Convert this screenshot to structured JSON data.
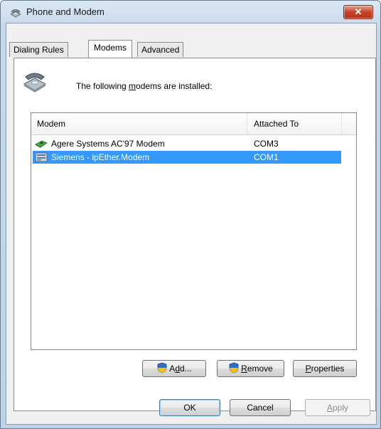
{
  "window": {
    "title": "Phone and Modem",
    "close_glyph": "✕"
  },
  "tabs": [
    {
      "label": "Dialing Rules",
      "selected": false
    },
    {
      "label": "Modems",
      "selected": true
    },
    {
      "label": "Advanced",
      "selected": false
    }
  ],
  "modems_tab": {
    "intro_pre": "The following ",
    "intro_ul": "m",
    "intro_post": "odems are installed:",
    "columns": [
      "Modem",
      "Attached To"
    ],
    "rows": [
      {
        "name": "Agere Systems AC'97 Modem",
        "port": "COM3",
        "icon": "modem-card-icon",
        "selected": false
      },
      {
        "name": "Siemens - ipEther.Modem",
        "port": "COM1",
        "icon": "modem-device-icon",
        "selected": true
      }
    ],
    "buttons": {
      "add": {
        "pre": "A",
        "ul": "d",
        "post": "d..."
      },
      "remove": {
        "ul": "R",
        "post": "emove"
      },
      "properties": {
        "ul": "P",
        "post": "roperties"
      }
    }
  },
  "footer": {
    "ok": "OK",
    "cancel": "Cancel",
    "apply": {
      "ul": "A",
      "post": "pply",
      "disabled": true
    }
  },
  "colors": {
    "selection": "#3399ff",
    "close": "#c5432b"
  }
}
